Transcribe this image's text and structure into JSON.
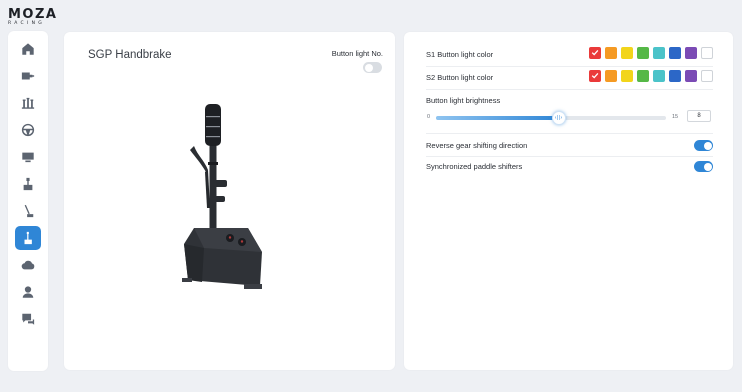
{
  "brand": {
    "name": "MOZA",
    "sub": "RACING"
  },
  "sidebar": {
    "items": [
      {
        "icon": "home-icon",
        "active": false
      },
      {
        "icon": "wheelbase-icon",
        "active": false
      },
      {
        "icon": "pedals-icon",
        "active": false
      },
      {
        "icon": "steering-wheel-icon",
        "active": false
      },
      {
        "icon": "dashboard-icon",
        "active": false
      },
      {
        "icon": "shifter-icon",
        "active": false
      },
      {
        "icon": "handbrake-icon",
        "active": false
      },
      {
        "icon": "sgp-handbrake-icon",
        "active": true
      },
      {
        "icon": "cloud-icon",
        "active": false
      },
      {
        "icon": "user-icon",
        "active": false
      },
      {
        "icon": "feedback-icon",
        "active": false
      }
    ]
  },
  "device": {
    "title": "SGP Handbrake",
    "button_light_label": "Button light No.",
    "button_light_on": false
  },
  "settings": {
    "s1_label": "S1 Button light color",
    "s2_label": "S2 Button light color",
    "palette": [
      "#ea3a3a",
      "#f59a23",
      "#f2d51b",
      "#55b847",
      "#4bc3c9",
      "#2c67c7",
      "#7b4bb5",
      "#ffffff"
    ],
    "s1_selected_index": 0,
    "s2_selected_index": 0,
    "brightness": {
      "label": "Button light brightness",
      "min": "0",
      "max": "15",
      "value": "8",
      "thumb_glyph": "‹||›"
    },
    "reverse_gear": {
      "label": "Reverse gear shifting direction",
      "on": true
    },
    "sync_paddles": {
      "label": "Synchronized paddle shifters",
      "on": true
    }
  }
}
